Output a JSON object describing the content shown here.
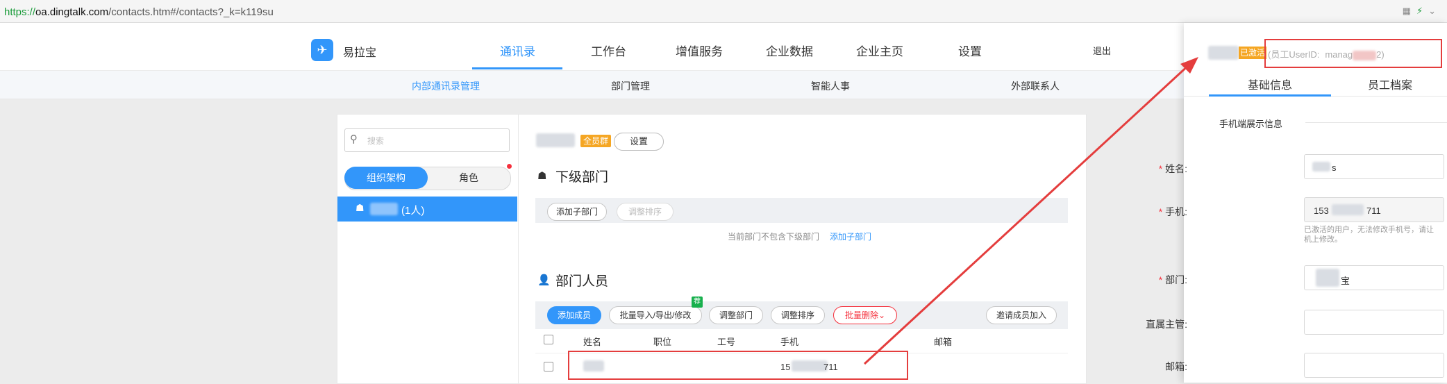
{
  "browser": {
    "url_protocol": "https://",
    "url_host": "oa.dingtalk.com",
    "url_path": "/contacts.htm#/contacts?_k=k119su"
  },
  "header": {
    "company": "易拉宝",
    "nav": [
      "通讯录",
      "工作台",
      "增值服务",
      "企业数据",
      "企业主页",
      "设置"
    ],
    "active_nav": "通讯录",
    "logout": "退出"
  },
  "subnav": {
    "items": [
      "内部通讯录管理",
      "部门管理",
      "智能人事",
      "外部联系人"
    ],
    "active": "内部通讯录管理"
  },
  "left_panel": {
    "search_placeholder": "搜索",
    "toggle": [
      "组织架构",
      "角色"
    ],
    "tree_root_count": "(1人)"
  },
  "main": {
    "all_staff_tag": "全员群",
    "settings_button": "设置",
    "subdept_title": "下级部门",
    "add_subdept": "添加子部门",
    "adjust_order": "调整排序",
    "no_subdept_hint": "当前部门不包含下级部门",
    "add_subdept_link": "添加子部门",
    "members_title": "部门人员",
    "member_buttons": [
      "添加成员",
      "批量导入/导出/修改",
      "调整部门",
      "调整排序",
      "批量删除"
    ],
    "recommend_badge": "荐",
    "invite_button": "邀请成员加入",
    "table_headers": [
      "姓名",
      "职位",
      "工号",
      "手机",
      "邮箱"
    ],
    "row": {
      "phone_start": "15",
      "phone_end": "711"
    }
  },
  "detail_panel": {
    "activated_tag": "已激活",
    "userid_label": "(员工UserID:",
    "userid_partial": "manag",
    "userid_end": "2)",
    "tabs": [
      "基础信息",
      "员工档案"
    ],
    "active_tab": "基础信息",
    "section": "手机端展示信息",
    "fields": {
      "name_label": "姓名:",
      "name_partial": "s",
      "phone_label": "手机:",
      "phone_start": "153",
      "phone_end": "711",
      "phone_note_1": "已激活的用户，无法修改手机号，请让",
      "phone_note_2": "机上修改。",
      "dept_label": "部门:",
      "dept_partial": "宝",
      "manager_label": "直属主管:",
      "email_label": "邮箱:"
    }
  },
  "colors": {
    "accent": "#3296fa",
    "annotation_red": "#e43d3d",
    "tag_orange": "#f5a623"
  }
}
